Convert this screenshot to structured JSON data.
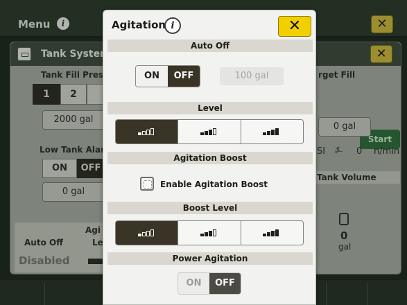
{
  "background": {
    "menu_label": "Menu",
    "tank_panel": {
      "title": "Tank System",
      "tank_fill_preset": "Tank Fill Prese",
      "preset_buttons": [
        "1",
        "2"
      ],
      "preset_volume": "2000 gal",
      "low_tank_alarm": "Low Tank Alar",
      "alarm_on": "ON",
      "alarm_off": "OFF",
      "alarm_volume": "0 gal",
      "agitation_partial": "Agi",
      "level_partial": "Le",
      "auto_off_col": "Auto Off",
      "auto_off_value": "Disabled",
      "target_fill": "rget Fill",
      "start_button": "Start",
      "target_volume": "0 gal",
      "psi_fragment": "SI",
      "flow_value": "0",
      "flow_unit": "n/min",
      "tank_volume": "Tank Volume",
      "tank_volume_value": "0",
      "tank_volume_unit": "gal"
    }
  },
  "modal": {
    "title": "Agitation",
    "info_icon": "i",
    "close_icon": "✕",
    "auto_off": {
      "header": "Auto Off",
      "on_label": "ON",
      "off_label": "OFF",
      "selected": "OFF",
      "volume_value": "100 gal"
    },
    "level": {
      "header": "Level",
      "options": [
        "low",
        "medium",
        "high"
      ],
      "selected_index": 0
    },
    "agitation_boost": {
      "header": "Agitation Boost",
      "checkbox_label": "Enable Agitation Boost",
      "checked": false
    },
    "boost_level": {
      "header": "Boost Level",
      "options": [
        "low",
        "medium",
        "high"
      ],
      "selected_index": 0
    },
    "power_agitation": {
      "header": "Power Agitation",
      "on_label": "ON",
      "off_label": "OFF",
      "selected": "OFF"
    }
  },
  "colors": {
    "accent_yellow": "#f2d000",
    "selected_dark": "#3a3426",
    "start_green": "#2e6a3a"
  }
}
